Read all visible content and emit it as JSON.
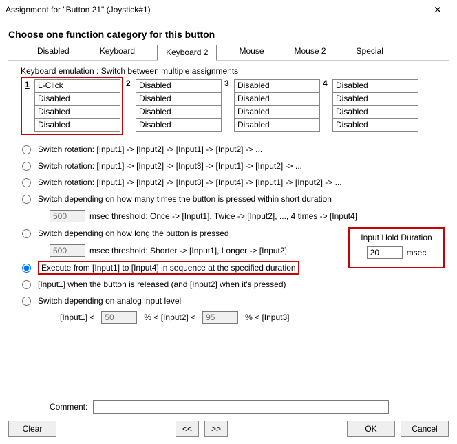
{
  "window": {
    "title": "Assignment for \"Button 21\" (Joystick#1)"
  },
  "heading": "Choose one function category for this button",
  "tabs": {
    "t0": "Disabled",
    "t1": "Keyboard",
    "t2": "Keyboard 2",
    "t3": "Mouse",
    "t4": "Mouse 2",
    "t5": "Special"
  },
  "subhead": "Keyboard emulation : Switch between multiple assignments",
  "cols": {
    "h1": "1",
    "h2": "2",
    "h3": "3",
    "h4": "4"
  },
  "grid": {
    "c1": {
      "r1": "L-Click",
      "r2": "Disabled",
      "r3": "Disabled",
      "r4": "Disabled"
    },
    "c2": {
      "r1": "Disabled",
      "r2": "Disabled",
      "r3": "Disabled",
      "r4": "Disabled"
    },
    "c3": {
      "r1": "Disabled",
      "r2": "Disabled",
      "r3": "Disabled",
      "r4": "Disabled"
    },
    "c4": {
      "r1": "Disabled",
      "r2": "Disabled",
      "r3": "Disabled",
      "r4": "Disabled"
    }
  },
  "radios": {
    "r1": "Switch rotation: [Input1] -> [Input2] -> [Input1] -> [Input2] -> ...",
    "r2": "Switch rotation: [Input1] -> [Input2] -> [Input3] -> [Input1] -> [Input2] -> ...",
    "r3": "Switch rotation: [Input1] -> [Input2] -> [Input3] -> [Input4] -> [Input1] -> [Input2] -> ...",
    "r4": "Switch depending on how many times the button is pressed within short duration",
    "r4_sub_val": "500",
    "r4_sub_txt": "msec threshold: Once -> [Input1], Twice -> [Input2], ..., 4 times -> [Input4]",
    "r5": "Switch depending on how long the button is pressed",
    "r5_sub_val": "500",
    "r5_sub_txt": "msec threshold: Shorter -> [Input1], Longer -> [Input2]",
    "r6": "Execute from [Input1] to [Input4] in sequence at the specified duration",
    "r7": "[Input1] when the button is released (and [Input2] when it's pressed)",
    "r8": "Switch depending on analog input level"
  },
  "analog": {
    "a1": "[Input1]   <",
    "v1": "50",
    "p1": "%   <  [Input2]   <",
    "v2": "95",
    "p2": "%   <  [Input3]"
  },
  "hold": {
    "label": "Input Hold Duration",
    "value": "20",
    "unit": "msec"
  },
  "comment": {
    "label": "Comment:",
    "value": ""
  },
  "buttons": {
    "clear": "Clear",
    "prev": "<<",
    "next": ">>",
    "ok": "OK",
    "cancel": "Cancel"
  }
}
